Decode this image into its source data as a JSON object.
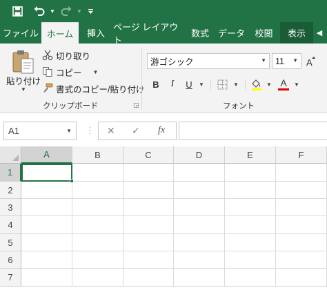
{
  "quick_access": {
    "save_icon": "save-icon",
    "undo_icon": "undo-icon",
    "redo_icon": "redo-icon",
    "customize_icon": "customize-toolbar-icon"
  },
  "tabs": [
    {
      "label": "ファイル",
      "active": false
    },
    {
      "label": "ホーム",
      "active": true
    },
    {
      "label": "挿入",
      "active": false
    },
    {
      "label": "ページ レイアウト",
      "active": false
    },
    {
      "label": "数式",
      "active": false
    },
    {
      "label": "データ",
      "active": false
    },
    {
      "label": "校閲",
      "active": false
    },
    {
      "label": "表示",
      "active": false
    }
  ],
  "ribbon": {
    "clipboard": {
      "paste_label": "貼り付け",
      "cut_label": "切り取り",
      "copy_label": "コピー",
      "format_painter_label": "書式のコピー/貼り付け",
      "group_label": "クリップボード"
    },
    "font": {
      "font_name": "游ゴシック",
      "font_size": "11",
      "bold_label": "B",
      "italic_label": "I",
      "underline_label": "U",
      "font_color_label": "A",
      "group_label": "フォント"
    }
  },
  "formula_bar": {
    "name_box": "A1",
    "cancel_label": "✕",
    "enter_label": "✓",
    "function_label": "fx",
    "formula_value": ""
  },
  "sheet": {
    "columns": [
      "A",
      "B",
      "C",
      "D",
      "E",
      "F"
    ],
    "rows": [
      "1",
      "2",
      "3",
      "4",
      "5",
      "6",
      "7"
    ],
    "selected_cell": "A1"
  },
  "colors": {
    "accent": "#217346",
    "ribbon_bg": "#f3f3f3",
    "font_color_swatch": "#e00000"
  }
}
